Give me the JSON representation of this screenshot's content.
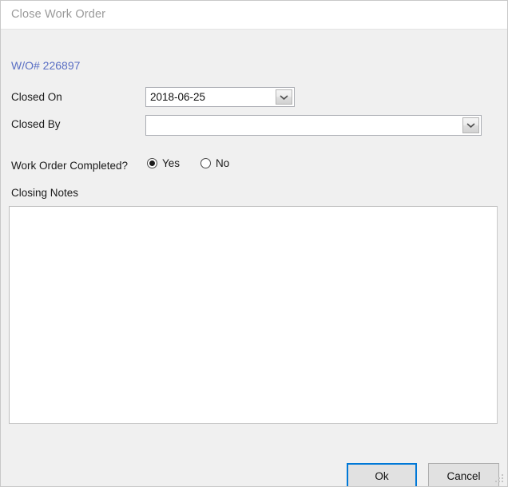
{
  "window": {
    "title": "Close Work Order"
  },
  "form": {
    "work_order_number": "W/O# 226897",
    "closed_on": {
      "label": "Closed On",
      "value": "2018-06-25"
    },
    "closed_by": {
      "label": "Closed By",
      "value": "",
      "placeholder": ""
    },
    "completed": {
      "label": "Work Order Completed?",
      "options": [
        {
          "label": "Yes",
          "selected": true
        },
        {
          "label": "No",
          "selected": false
        }
      ]
    },
    "closing_notes": {
      "label": "Closing Notes",
      "value": ""
    }
  },
  "buttons": {
    "ok": "Ok",
    "cancel": "Cancel"
  },
  "colors": {
    "window_background": "#f0f0f0",
    "titlebar_background": "#ffffff",
    "title_text": "#9a9a9a",
    "work_order_link": "#5a6fc4",
    "accent_focus": "#0078d7",
    "field_border": "#abadb3",
    "button_face": "#e1e1e1"
  }
}
